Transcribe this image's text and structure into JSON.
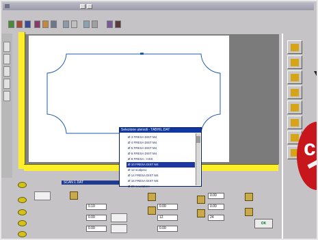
{
  "window": {
    "title": ""
  },
  "toolbar": {
    "tools": [
      {
        "icon": "new-file-icon"
      },
      {
        "icon": "open-folder-icon"
      },
      {
        "icon": "save-icon"
      },
      {
        "icon": "print-icon"
      },
      {
        "icon": "cut-icon"
      },
      {
        "icon": "copy-icon"
      },
      {
        "icon": "paste-icon"
      },
      {
        "icon": "undo-icon"
      },
      {
        "icon": "zoom-icon"
      },
      {
        "icon": "grid-icon"
      },
      {
        "icon": "layer-icon"
      },
      {
        "icon": "settings-icon"
      }
    ]
  },
  "popup": {
    "title": "Selezione utensili - TABHIL.DAT",
    "items": [
      "Ø 3  FRESA DIST M4",
      "Ø 4  FRESA DIST M4",
      "Ø 5  FRESA DIST M4",
      "Ø 6  FRESA DIST M4",
      "Ø 8  FRESA - HSS",
      "Ø 10  FRESA DIST M4",
      "Ø 12  scalpino",
      "Ø 14  FRESA DIST M4",
      "Ø 16  FRESA DIST M4",
      "Ø 20  svuotatore"
    ],
    "selected_index": 5
  },
  "bottom_panel": {
    "header": "SCAN 1    DAT",
    "fields": {
      "f1": "0.10",
      "f2": "0.00",
      "f3": "0.00",
      "f4": "0.00",
      "f5": "12",
      "f6": "0.00",
      "f7": "0.00",
      "f8": "0.00",
      "f9": "24"
    },
    "ok_label": "OK"
  },
  "colors": {
    "ruler": "#ffef2a",
    "selection": "#1c36a2",
    "accent_red": "#c8161d"
  }
}
